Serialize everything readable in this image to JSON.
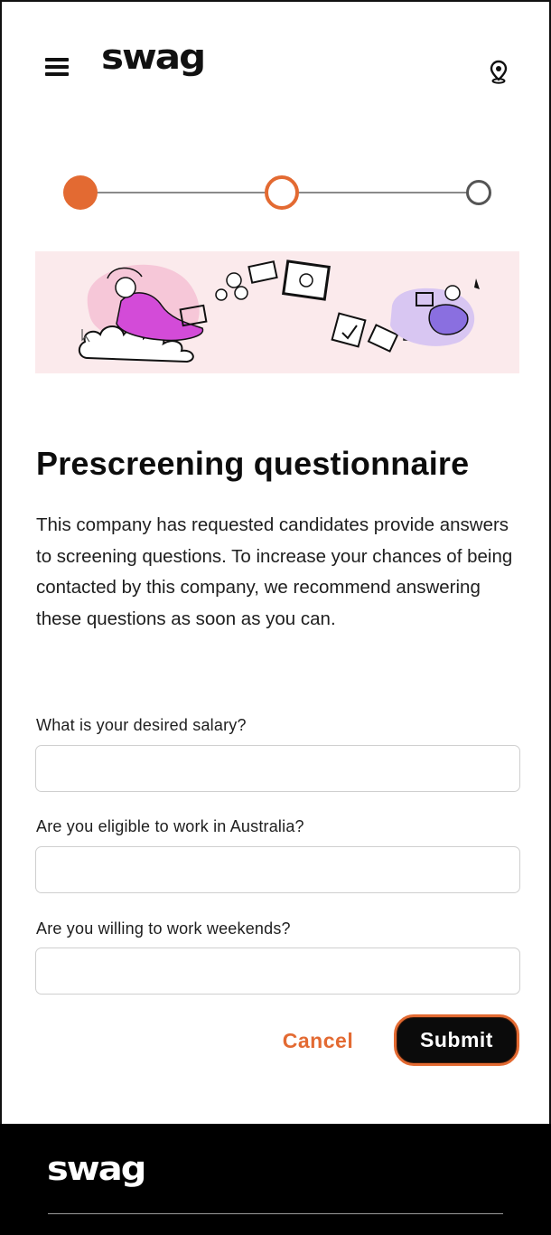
{
  "header": {
    "brand": "swag",
    "menu_icon": "hamburger-menu-icon",
    "location_icon": "location-pin-icon"
  },
  "stepper": {
    "total_steps": 3,
    "completed_steps": 1,
    "current_step": 2,
    "accent_color": "#e36a32"
  },
  "banner": {
    "illustration": "work-from-anywhere-illustration",
    "background_color": "#fbeaec"
  },
  "main": {
    "title": "Prescreening questionnaire",
    "intro": "This company has requested candidates provide answers to screening questions. To increase your chances of being contacted by this company, we recommend answering these questions as soon as you can."
  },
  "questions": [
    {
      "label": "What is your desired salary?",
      "value": ""
    },
    {
      "label": "Are you eligible to work in Australia?",
      "value": ""
    },
    {
      "label": "Are you willing to work weekends?",
      "value": ""
    }
  ],
  "actions": {
    "cancel_label": "Cancel",
    "submit_label": "Submit"
  },
  "footer": {
    "brand": "swag"
  },
  "colors": {
    "accent": "#e36a32",
    "footer_bg": "#000000",
    "text": "#111111"
  }
}
